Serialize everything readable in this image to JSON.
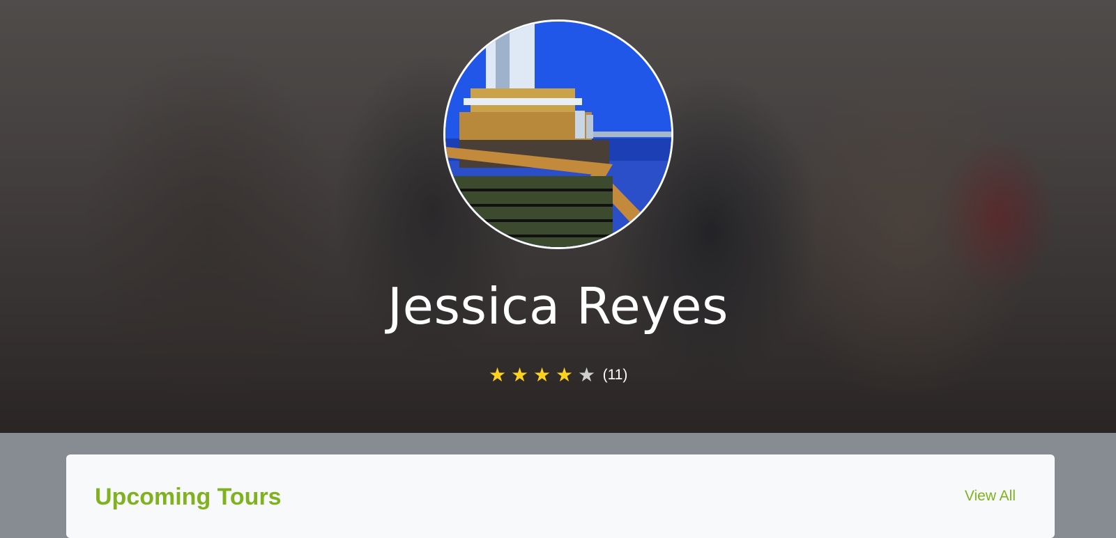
{
  "profile": {
    "name": "Jessica Reyes",
    "rating": {
      "stars_filled": 4,
      "stars_total": 5,
      "count_label": "(11)"
    },
    "star_glyph": "★"
  },
  "tours": {
    "title": "Upcoming Tours",
    "view_all_label": "View All"
  },
  "colors": {
    "accent": "#7fb21e",
    "star_on": "#ffd21e",
    "star_off": "#cfcfcf"
  }
}
